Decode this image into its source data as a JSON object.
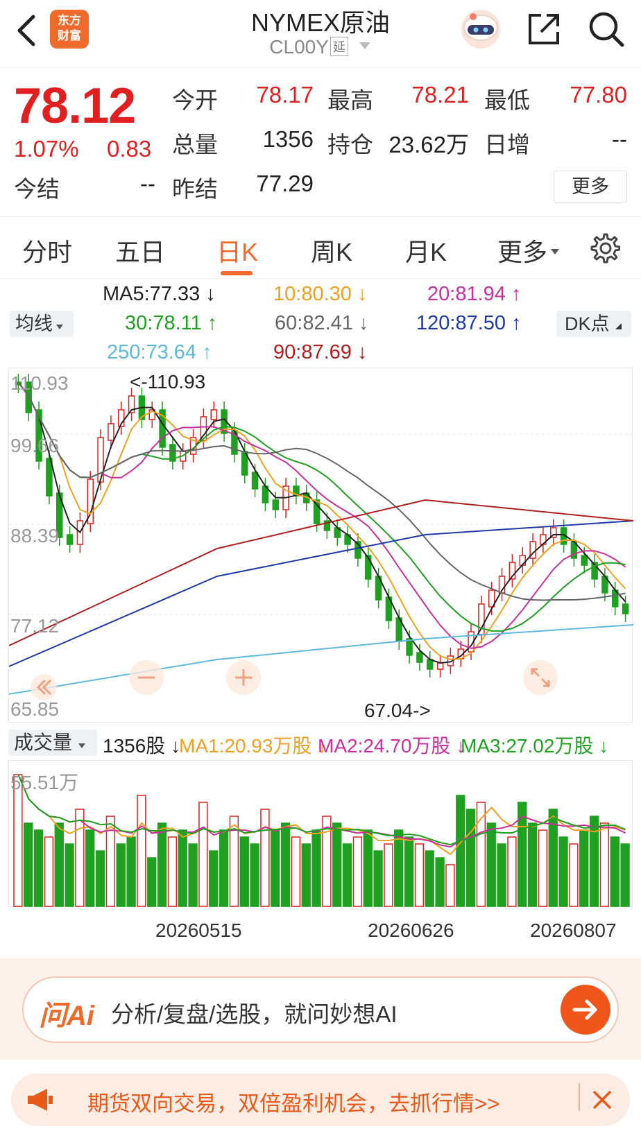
{
  "header": {
    "title": "NYMEX原油",
    "subtitle": "CL00Y",
    "tag": "延",
    "logo_line1": "东方",
    "logo_line2": "财富"
  },
  "quote": {
    "price": "78.12",
    "change_pct": "1.07%",
    "change": "0.83",
    "fields": [
      {
        "label": "今开",
        "value": "78.17"
      },
      {
        "label": "最高",
        "value": "78.21"
      },
      {
        "label": "最低",
        "value": "77.80"
      },
      {
        "label": "总量",
        "value": "1356"
      },
      {
        "label": "持仓",
        "value": "23.62万"
      },
      {
        "label": "日增",
        "value": "--"
      },
      {
        "label": "今结",
        "value": "--"
      },
      {
        "label": "昨结",
        "value": "77.29"
      }
    ],
    "more": "更多"
  },
  "tabs": [
    "分时",
    "五日",
    "日K",
    "周K",
    "月K",
    "更多"
  ],
  "ma": {
    "selector": "均线",
    "dk": "DK点",
    "items": [
      {
        "text": "MA5:77.33 ↓",
        "color": "#222222"
      },
      {
        "text": "10:80.30 ↓",
        "color": "#f0a020"
      },
      {
        "text": "20:81.94 ↑",
        "color": "#c8309c"
      },
      {
        "text": "30:78.11 ↑",
        "color": "#20a020"
      },
      {
        "text": "60:82.41 ↓",
        "color": "#666666"
      },
      {
        "text": "120:87.50 ↑",
        "color": "#1f3aa8"
      },
      {
        "text": "250:73.64 ↑",
        "color": "#5fb8e0"
      },
      {
        "text": "90:87.69 ↓",
        "color": "#b01e1e"
      }
    ]
  },
  "kline": {
    "y_labels": [
      "110.93",
      "99.66",
      "88.39",
      "77.12",
      "65.85"
    ],
    "high_label": "<-110.93",
    "low_label": "67.04->"
  },
  "volume": {
    "selector": "成交量",
    "items": [
      {
        "text": "1356股 ↓",
        "color": "#222222"
      },
      {
        "text": "MA1:20.93万股 ↓",
        "color": "#f0a020"
      },
      {
        "text": "MA2:24.70万股 ↓",
        "color": "#c8309c"
      },
      {
        "text": "MA3:27.02万股 ↓",
        "color": "#20a020"
      }
    ],
    "y_label": "55.51万"
  },
  "dates": [
    "20260515",
    "20260626",
    "20260807"
  ],
  "ai": {
    "logo": "问Ai",
    "text": "分析/复盘/选股，就问妙想AI"
  },
  "ad": {
    "text": "期货双向交易，双倍盈利机会，去抓行情>>"
  },
  "colors": {
    "up": "#e02020",
    "down": "#20a020",
    "accent": "#ef6a2b"
  }
}
